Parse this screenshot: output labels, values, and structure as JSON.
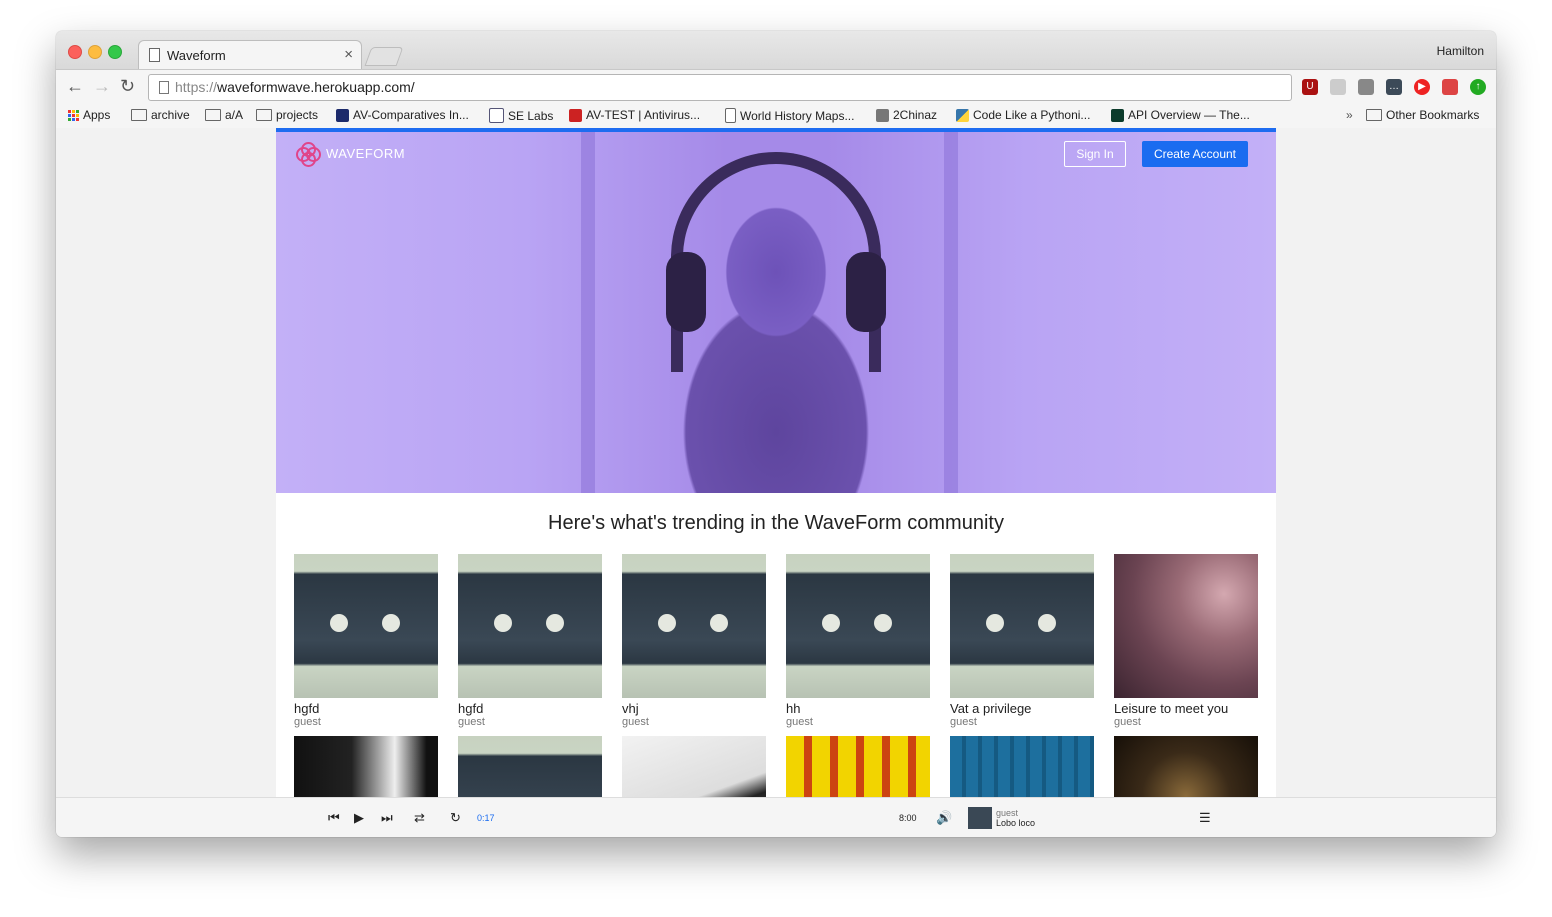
{
  "browser": {
    "tab_title": "Waveform",
    "tab_close": "×",
    "profile": "Hamilton",
    "url_scheme": "https://",
    "url_host": "waveformwave.herokuapp.com/"
  },
  "bookmarks": {
    "items": [
      "Apps",
      "archive",
      "a/A",
      "projects",
      "AV-Comparatives In...",
      "SE Labs",
      "AV-TEST | Antivirus...",
      "World History Maps...",
      "2Chinaz",
      "Code Like a Pythoni...",
      "API Overview — The..."
    ],
    "overflow": "»",
    "other": "Other Bookmarks"
  },
  "site": {
    "logo_text": "WAVEFORM",
    "sign_in": "Sign In",
    "create_account": "Create Account",
    "heading": "Here's what's trending in the WaveForm community",
    "tracks": [
      {
        "title": "hgfd",
        "user": "guest"
      },
      {
        "title": "hgfd",
        "user": "guest"
      },
      {
        "title": "vhj",
        "user": "guest"
      },
      {
        "title": "hh",
        "user": "guest"
      },
      {
        "title": "Vat a privilege",
        "user": "guest"
      },
      {
        "title": "Leisure to meet you",
        "user": "guest"
      }
    ]
  },
  "player": {
    "current_time": "0:17",
    "duration": "8:00",
    "now_playing_user": "guest",
    "now_playing_title": "Lobo loco"
  },
  "colors": {
    "accent": "#1a6cf0",
    "logo": "#e0458a",
    "hero_tint": "#b9a4f4"
  }
}
